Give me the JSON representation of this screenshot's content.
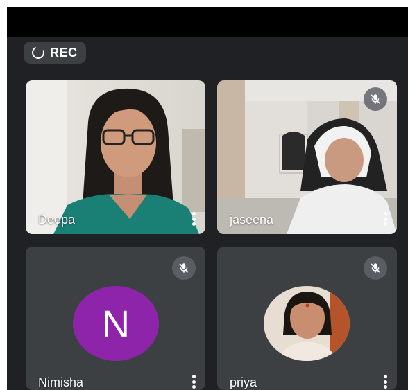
{
  "recording": {
    "label": "REC"
  },
  "participants": [
    {
      "name": "Deepa"
    },
    {
      "name": "jaseena"
    },
    {
      "name": "Nimisha",
      "initial": "N"
    },
    {
      "name": "priya"
    }
  ],
  "colors": {
    "background": "#202124",
    "tile": "#3c4043",
    "avatar_n": "#8e24aa"
  },
  "icons": {
    "record": "record-spinner-icon",
    "muted": "mic-off-icon",
    "more": "more-vert-icon"
  }
}
